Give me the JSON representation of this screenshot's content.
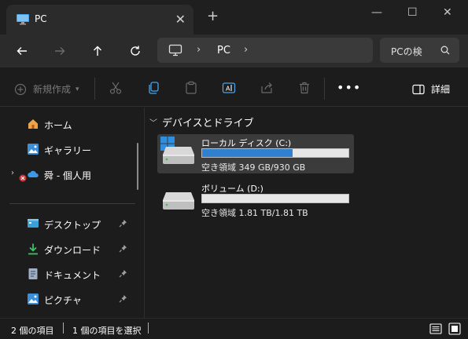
{
  "window": {
    "tab_title": "PC",
    "tab_close": "✕",
    "new_tab": "+",
    "minimize": "—",
    "maximize": "☐",
    "close": "✕"
  },
  "address": {
    "crumb_current": "PC",
    "search_placeholder": "PCの検"
  },
  "toolbar": {
    "new_label": "新規作成",
    "more_label": "•••",
    "details_label": "詳細"
  },
  "sidebar": {
    "items": [
      {
        "label": "ホーム",
        "icon": "home-icon"
      },
      {
        "label": "ギャラリー",
        "icon": "gallery-icon"
      },
      {
        "label": "舜 - 個人用",
        "icon": "onedrive-icon"
      },
      {
        "label": "デスクトップ",
        "icon": "desktop-icon",
        "pinned": true
      },
      {
        "label": "ダウンロード",
        "icon": "download-icon",
        "pinned": true
      },
      {
        "label": "ドキュメント",
        "icon": "document-icon",
        "pinned": true
      },
      {
        "label": "ピクチャ",
        "icon": "pictures-icon",
        "pinned": true
      }
    ]
  },
  "main": {
    "group_title": "デバイスとドライブ",
    "drives": [
      {
        "name": "ローカル ディスク (C:)",
        "space": "空き領域 349 GB/930 GB",
        "used_fraction": 0.62,
        "selected": true
      },
      {
        "name": "ボリューム (D:)",
        "space": "空き領域 1.81 TB/1.81 TB",
        "used_fraction": 0.0,
        "selected": false
      }
    ]
  },
  "status": {
    "count": "2 個の項目",
    "selected": "1 個の項目を選択"
  },
  "colors": {
    "accent": "#2f80d0",
    "background": "#1c1c1c",
    "chrome": "#2b2b2b"
  }
}
